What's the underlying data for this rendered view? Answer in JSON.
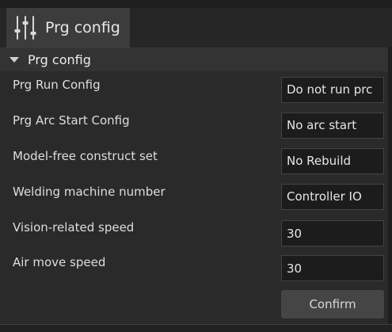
{
  "tab": {
    "label": "Prg config",
    "icon": "sliders-icon"
  },
  "section": {
    "title": "Prg config",
    "expanded": true
  },
  "rows": [
    {
      "label": "Prg Run Config",
      "value": "Do not run prc"
    },
    {
      "label": "Prg Arc Start Config",
      "value": "No arc start"
    },
    {
      "label": "Model-free construct set",
      "value": "No Rebuild"
    },
    {
      "label": "Welding machine number",
      "value": "Controller IO"
    },
    {
      "label": "Vision-related speed",
      "value": "30"
    },
    {
      "label": "Air move speed",
      "value": "30"
    }
  ],
  "confirm_label": "Confirm",
  "colors": {
    "background": "#2a2a2a",
    "tab_active": "#3c3c3c",
    "section_header": "#333333",
    "field_bg": "#1c1c1c",
    "button_bg": "#454545"
  }
}
